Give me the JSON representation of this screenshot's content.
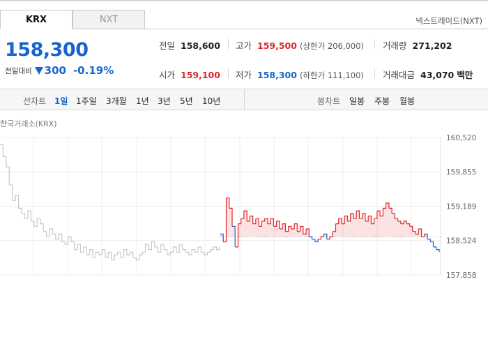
{
  "tabs": [
    {
      "label": "KRX",
      "active": true
    },
    {
      "label": "NXT",
      "active": false
    }
  ],
  "nxt_link": "넥스트레이드(NXT)",
  "price": "158,300",
  "change": {
    "label": "전일대비",
    "direction": "down",
    "amount": "300",
    "percent": "-0.19%"
  },
  "stats": {
    "prev_close": {
      "label": "전일",
      "value": "158,600"
    },
    "high": {
      "label": "고가",
      "value": "159,500",
      "sub": "(상한가 206,000)"
    },
    "volume": {
      "label": "거래량",
      "value": "271,202"
    },
    "open": {
      "label": "시가",
      "value": "159,100"
    },
    "low": {
      "label": "저가",
      "value": "158,300",
      "sub": "(하한가 111,100)"
    },
    "amount": {
      "label": "거래대금",
      "value": "43,070",
      "unit": "백만"
    }
  },
  "period_bar": {
    "line_label": "선차트",
    "line_items": [
      "1일",
      "1주일",
      "3개월",
      "1년",
      "3년",
      "5년",
      "10년"
    ],
    "line_active": "1일",
    "candle_label": "봉차트",
    "candle_items": [
      "일봉",
      "주봉",
      "월봉"
    ]
  },
  "exchange_caption": "한국거래소(KRX)",
  "colors": {
    "up": "#e0262c",
    "down": "#1764d0",
    "prev_session": "#c8c8c8"
  },
  "chart_data": {
    "type": "line",
    "y_ticks": [
      "160,520",
      "159,855",
      "159,189",
      "158,524",
      "157,858"
    ],
    "ylim": [
      157858,
      160520
    ],
    "reference_price": 158600,
    "previous_session": [
      160380,
      160150,
      159950,
      159600,
      159300,
      159400,
      159150,
      159050,
      158950,
      159100,
      158900,
      158800,
      158950,
      158850,
      158700,
      158600,
      158750,
      158650,
      158550,
      158650,
      158500,
      158450,
      158600,
      158500,
      158350,
      158450,
      158300,
      158400,
      158250,
      158350,
      158200,
      158300,
      158250,
      158350,
      158200,
      158300,
      158150,
      158250,
      158300,
      158200,
      158350,
      158250,
      158300,
      158200,
      158150,
      158250,
      158300,
      158450,
      158350,
      158500,
      158400,
      158300,
      158450,
      158350,
      158250,
      158300,
      158400,
      158300,
      158450,
      158350,
      158300,
      158250,
      158350,
      158300,
      158400,
      158300,
      158250,
      158300,
      158350,
      158400,
      158350,
      158400
    ],
    "today": [
      158650,
      158500,
      159350,
      159150,
      158800,
      158400,
      158850,
      158950,
      159100,
      158900,
      159000,
      158850,
      158950,
      158800,
      158900,
      158950,
      158850,
      158950,
      158800,
      158900,
      158750,
      158850,
      158700,
      158800,
      158750,
      158850,
      158700,
      158800,
      158650,
      158750,
      158600,
      158550,
      158500,
      158550,
      158600,
      158650,
      158550,
      158600,
      158700,
      158850,
      158950,
      158850,
      159000,
      158900,
      159050,
      158950,
      159100,
      158950,
      159050,
      158900,
      159000,
      158850,
      158950,
      159100,
      159000,
      159150,
      159250,
      159150,
      159050,
      158950,
      158900,
      158850,
      158900,
      158850,
      158800,
      158700,
      158650,
      158750,
      158600,
      158650,
      158550,
      158500,
      158400,
      158350,
      158300
    ]
  }
}
